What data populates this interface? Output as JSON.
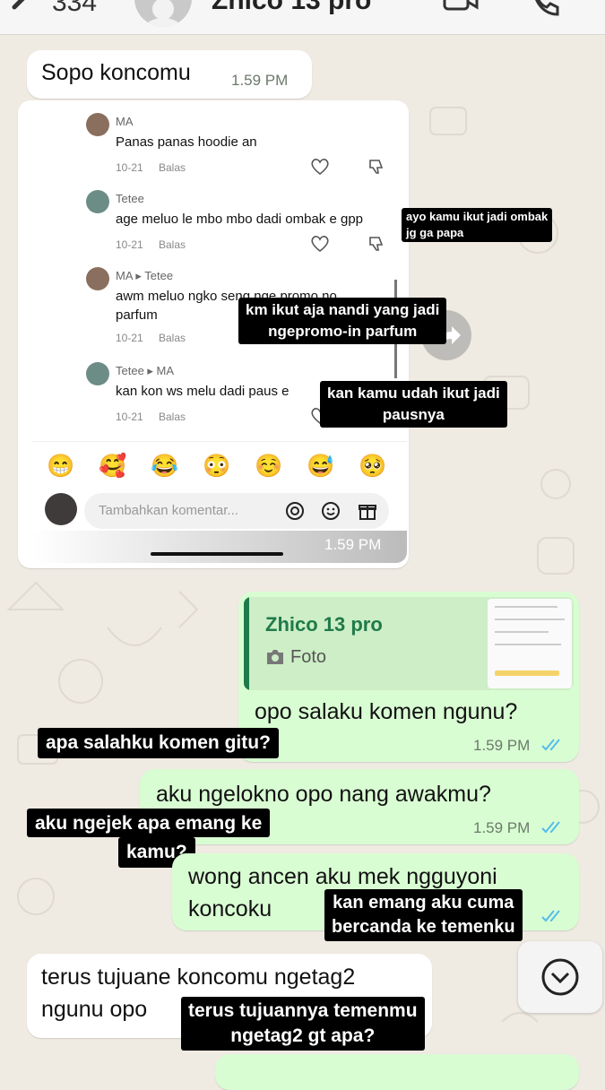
{
  "header": {
    "back_count": "334",
    "contact_name": "Zhico 13 pro"
  },
  "messages": {
    "m1_text": "Sopo koncomu",
    "m1_time": "1.59 PM",
    "image_time": "1.59 PM",
    "reply_name": "Zhico 13 pro",
    "reply_type": "Foto",
    "m2_text": "opo salaku komen ngunu?",
    "m2_time": "1.59 PM",
    "m3_text": "aku ngelokno opo nang awakmu?",
    "m3_time": "1.59 PM",
    "m4_line1": "wong ancen aku mek ngguyoni",
    "m4_line2": "koncoku",
    "m5_line1": "terus tujuane koncomu ngetag2",
    "m5_line2": "ngunu opo"
  },
  "screenshot": {
    "comments": [
      {
        "name": "MA",
        "text": "Panas panas hoodie an",
        "date": "10-21",
        "reply": "Balas"
      },
      {
        "name": "Tetee",
        "text": "age meluo le mbo mbo dadi ombak e gpp",
        "date": "10-21",
        "reply": "Balas"
      },
      {
        "name": "MA ▸ Tetee",
        "text": "awm meluo ngko seng nge promo no parfum",
        "date": "10-21",
        "reply": "Balas"
      },
      {
        "name": "Tetee ▸ MA",
        "text": "kan kon ws melu dadi paus e",
        "date": "10-21",
        "reply": "Balas"
      }
    ],
    "emojis": [
      "😁",
      "🥰",
      "😂",
      "😳",
      "☺️",
      "😅",
      "🥺"
    ],
    "comment_placeholder": "Tambahkan komentar..."
  },
  "captions": {
    "c1": "ayo kamu ikut jadi ombak\njg ga papa",
    "c2a": "km ikut aja nandi yang jadi",
    "c2b": "ngepromo-in parfum",
    "c3a": "kan kamu udah ikut jadi",
    "c3b": "pausnya",
    "c4": "apa salahku komen gitu?",
    "c5a": "aku ngejek apa emang ke",
    "c5b": "kamu?",
    "c6a": "kan emang aku cuma",
    "c6b": "bercanda ke temenku",
    "c7a": "terus tujuannya temenmu",
    "c7b": "ngetag2 gt apa?"
  },
  "colors": {
    "chat_bg": "#efeae2",
    "outgoing": "#d9fdd3",
    "incoming": "#ffffff",
    "reply_accent": "#1f7a4a",
    "tick_blue": "#53bdeb"
  }
}
